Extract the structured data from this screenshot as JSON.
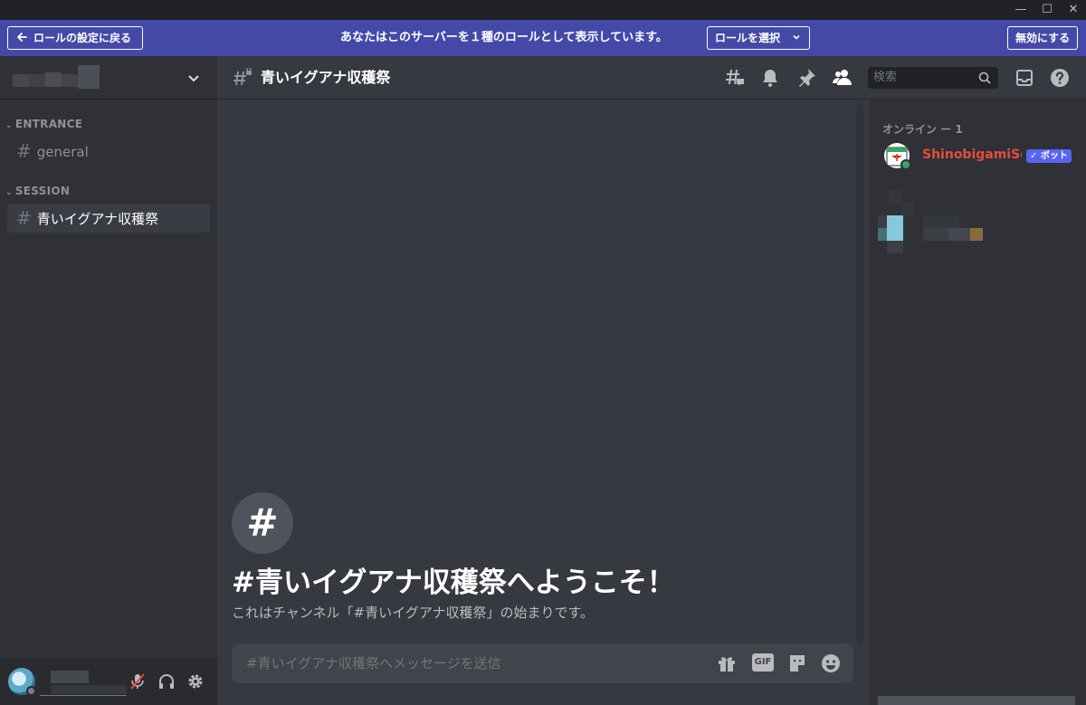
{
  "window": {
    "minimize": "—",
    "maximize": "☐",
    "close": "✕"
  },
  "banner": {
    "back_label": "ロールの設定に戻る",
    "message": "あなたはこのサーバーを１種のロールとして表示しています。",
    "select_roles_label": "ロールを選択",
    "disable_label": "無効にする",
    "color": "#4449a8"
  },
  "sidebar": {
    "categories": [
      {
        "name": "ENTRANCE",
        "channels": [
          {
            "label": "general",
            "active": false
          }
        ]
      },
      {
        "name": "SESSION",
        "channels": [
          {
            "label": "青いイグアナ収穫祭",
            "active": true
          }
        ]
      }
    ]
  },
  "chat": {
    "channel_name": "青いイグアナ収穫祭",
    "search_placeholder": "検索",
    "welcome_icon": "#",
    "welcome_title": "#青いイグアナ収穫祭へようこそ！",
    "welcome_subtitle": "これはチャンネル「#青いイグアナ収穫祭」の始まりです。",
    "composer_placeholder": "#青いイグアナ収穫祭へメッセージを送信",
    "gif_label": "GIF"
  },
  "members": {
    "section_title": "オンライン ー 1",
    "list": [
      {
        "name": "ShinobigamiSc...",
        "tag": "✓ ボット",
        "name_color": "#e74c3c",
        "status": "online"
      }
    ]
  },
  "icons": [
    "arrow-left-icon",
    "chevron-down-icon",
    "threads-icon",
    "bell-icon",
    "pin-icon",
    "members-icon",
    "search-icon",
    "inbox-icon",
    "help-icon",
    "gift-icon",
    "gif-icon",
    "sticker-icon",
    "emoji-icon",
    "microphone-muted-icon",
    "headphones-icon",
    "gear-icon"
  ],
  "colors": {
    "accent": "#5865f2",
    "bot_name": "#e74c3c",
    "online": "#3ba55d",
    "muted": "#ed4245"
  }
}
